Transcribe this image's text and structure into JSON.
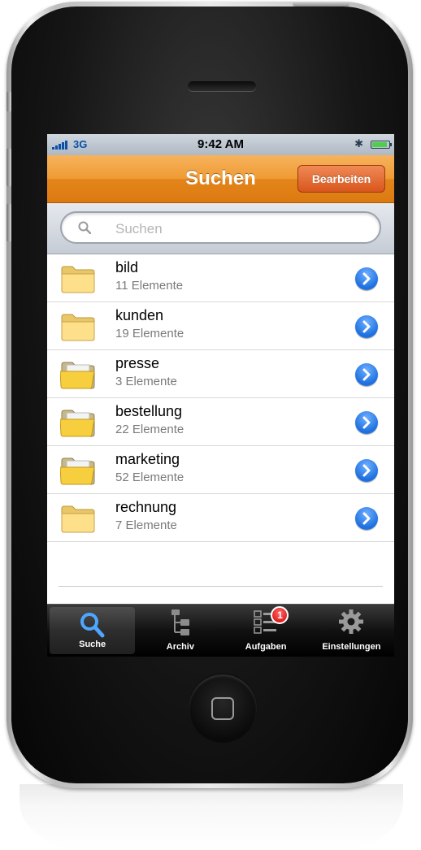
{
  "status_bar": {
    "carrier": "3G",
    "time": "9:42 AM",
    "bluetooth_icon": "bluetooth-icon",
    "battery_icon": "battery-icon"
  },
  "nav": {
    "title": "Suchen",
    "edit_label": "Bearbeiten",
    "color": "#ec952c",
    "edit_color": "#e06a32"
  },
  "search": {
    "placeholder": "Suchen"
  },
  "folders": [
    {
      "name": "bild",
      "count": "11 Elemente",
      "icon": "folder-icon"
    },
    {
      "name": "kunden",
      "count": "19 Elemente",
      "icon": "folder-icon"
    },
    {
      "name": "presse",
      "count": "3 Elemente",
      "icon": "folder-open-icon"
    },
    {
      "name": "bestellung",
      "count": "22 Elemente",
      "icon": "folder-open-icon"
    },
    {
      "name": "marketing",
      "count": "52 Elemente",
      "icon": "folder-open-icon"
    },
    {
      "name": "rechnung",
      "count": "7 Elemente",
      "icon": "folder-icon"
    }
  ],
  "tabs": [
    {
      "label": "Suche",
      "icon": "magnifier-icon",
      "selected": true
    },
    {
      "label": "Archiv",
      "icon": "archive-tree-icon"
    },
    {
      "label": "Aufgaben",
      "icon": "checklist-icon",
      "badge": "1"
    },
    {
      "label": "Einstellungen",
      "icon": "gear-icon"
    }
  ]
}
